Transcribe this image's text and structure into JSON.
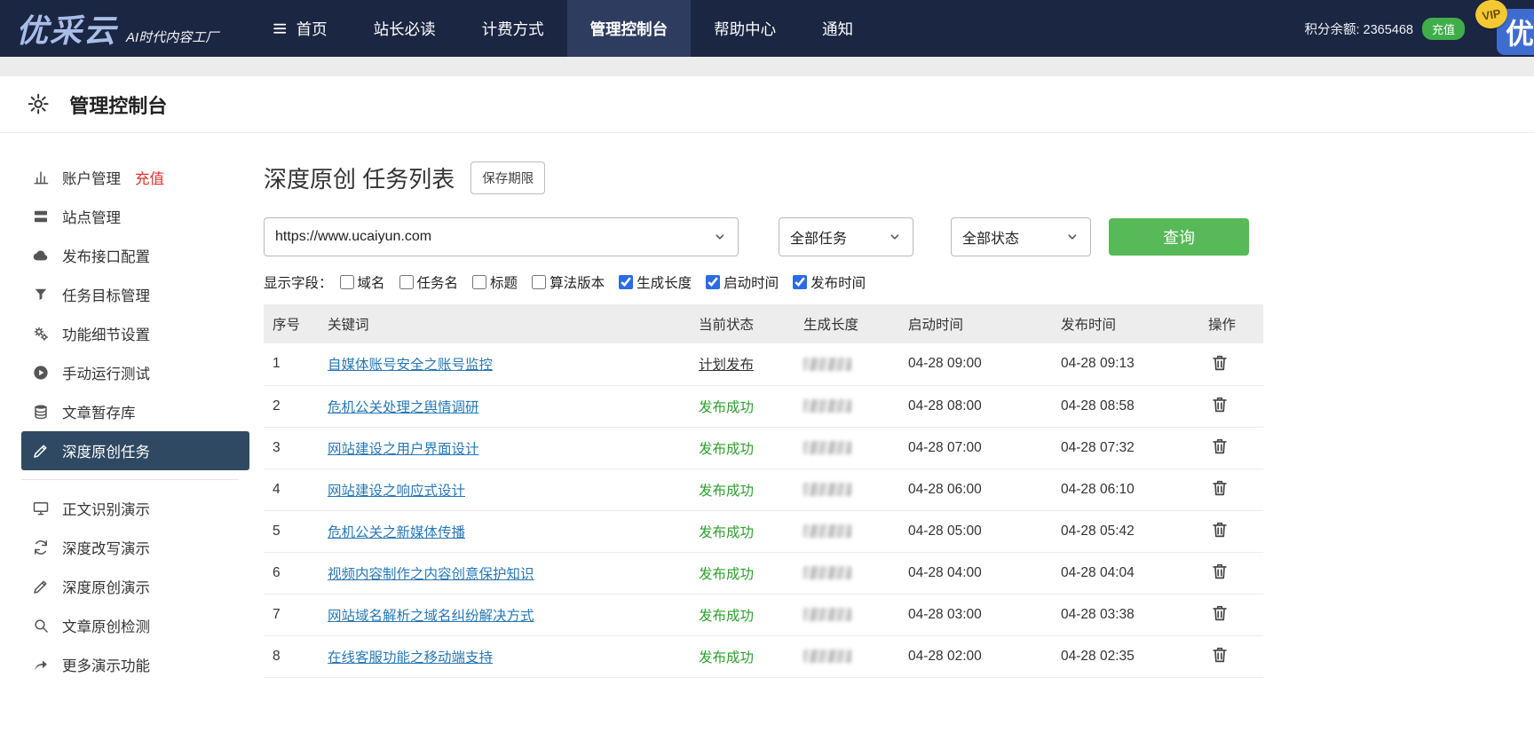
{
  "navbar": {
    "logo": {
      "brand": "优采云",
      "tagline": "AI时代内容工厂"
    },
    "items": [
      {
        "key": "home",
        "label": "首页",
        "icon": "menu-icon",
        "active": false
      },
      {
        "key": "must-read",
        "label": "站长必读",
        "active": false
      },
      {
        "key": "billing",
        "label": "计费方式",
        "active": false
      },
      {
        "key": "console",
        "label": "管理控制台",
        "active": true
      },
      {
        "key": "help-center",
        "label": "帮助中心",
        "active": false
      },
      {
        "key": "notifications",
        "label": "通知",
        "active": false
      }
    ],
    "points_label": "积分余额:",
    "points_value": "2365468",
    "recharge_label": "充值",
    "corner_logo": "优",
    "vip_label": "VIP"
  },
  "page_header": {
    "title": "管理控制台"
  },
  "sidebar": {
    "items": [
      {
        "key": "account",
        "label": "账户管理",
        "icon": "bar-chart-icon",
        "badge": "充值"
      },
      {
        "key": "sites",
        "label": "站点管理",
        "icon": "site-icon"
      },
      {
        "key": "publish-api",
        "label": "发布接口配置",
        "icon": "cloud-icon"
      },
      {
        "key": "task-target",
        "label": "任务目标管理",
        "icon": "funnel-icon"
      },
      {
        "key": "feature-detail",
        "label": "功能细节设置",
        "icon": "gears-icon"
      },
      {
        "key": "manual-test",
        "label": "手动运行测试",
        "icon": "play-icon"
      },
      {
        "key": "article-store",
        "label": "文章暂存库",
        "icon": "database-icon"
      },
      {
        "key": "deep-original-task",
        "label": "深度原创任务",
        "icon": "edit-icon",
        "active": true
      },
      {
        "divider": true
      },
      {
        "key": "demo-extract",
        "label": "正文识别演示",
        "icon": "monitor-icon"
      },
      {
        "key": "demo-rewrite",
        "label": "深度改写演示",
        "icon": "refresh-icon"
      },
      {
        "key": "demo-original",
        "label": "深度原创演示",
        "icon": "edit-icon"
      },
      {
        "key": "demo-check",
        "label": "文章原创检测",
        "icon": "search-icon"
      },
      {
        "key": "demo-more",
        "label": "更多演示功能",
        "icon": "arrow-icon"
      }
    ]
  },
  "main": {
    "title": "深度原创 任务列表",
    "save_period_button": "保存期限",
    "filters": {
      "site_select": "https://www.ucaiyun.com",
      "task_select": "全部任务",
      "status_select": "全部状态",
      "query_button": "查询"
    },
    "fields_label": "显示字段：",
    "field_checkboxes": [
      {
        "key": "domain",
        "label": "域名",
        "checked": false
      },
      {
        "key": "task-name",
        "label": "任务名",
        "checked": false
      },
      {
        "key": "title",
        "label": "标题",
        "checked": false
      },
      {
        "key": "algo-version",
        "label": "算法版本",
        "checked": false
      },
      {
        "key": "gen-length",
        "label": "生成长度",
        "checked": true
      },
      {
        "key": "start-time",
        "label": "启动时间",
        "checked": true
      },
      {
        "key": "publish-time",
        "label": "发布时间",
        "checked": true
      }
    ],
    "table": {
      "columns": [
        "序号",
        "关键词",
        "当前状态",
        "生成长度",
        "启动时间",
        "发布时间",
        "操作"
      ],
      "rows": [
        {
          "no": "1",
          "keyword": "自媒体账号安全之账号监控",
          "status": "计划发布",
          "status_type": "planned",
          "length_masked": true,
          "start_time": "04-28 09:00",
          "publish_time": "04-28 09:13"
        },
        {
          "no": "2",
          "keyword": "危机公关处理之舆情调研",
          "status": "发布成功",
          "status_type": "success",
          "length_masked": true,
          "start_time": "04-28 08:00",
          "publish_time": "04-28 08:58"
        },
        {
          "no": "3",
          "keyword": "网站建设之用户界面设计",
          "status": "发布成功",
          "status_type": "success",
          "length_masked": true,
          "start_time": "04-28 07:00",
          "publish_time": "04-28 07:32"
        },
        {
          "no": "4",
          "keyword": "网站建设之响应式设计",
          "status": "发布成功",
          "status_type": "success",
          "length_masked": true,
          "start_time": "04-28 06:00",
          "publish_time": "04-28 06:10"
        },
        {
          "no": "5",
          "keyword": "危机公关之新媒体传播",
          "status": "发布成功",
          "status_type": "success",
          "length_masked": true,
          "start_time": "04-28 05:00",
          "publish_time": "04-28 05:42"
        },
        {
          "no": "6",
          "keyword": "视频内容制作之内容创意保护知识",
          "status": "发布成功",
          "status_type": "success",
          "length_masked": true,
          "start_time": "04-28 04:00",
          "publish_time": "04-28 04:04"
        },
        {
          "no": "7",
          "keyword": "网站域名解析之域名纠纷解决方式",
          "status": "发布成功",
          "status_type": "success",
          "length_masked": true,
          "start_time": "04-28 03:00",
          "publish_time": "04-28 03:38"
        },
        {
          "no": "8",
          "keyword": "在线客服功能之移动端支持",
          "status": "发布成功",
          "status_type": "success",
          "length_masked": true,
          "start_time": "04-28 02:00",
          "publish_time": "04-28 02:35"
        }
      ]
    }
  },
  "colors": {
    "navbar_bg": "#1b2642",
    "active_nav_bg": "#2e3c60",
    "sidebar_active_bg": "#2f4962",
    "accent_green": "#57b957",
    "success_green": "#2ca02c",
    "link_blue": "#2878b5",
    "recharge_red": "#e03030"
  }
}
